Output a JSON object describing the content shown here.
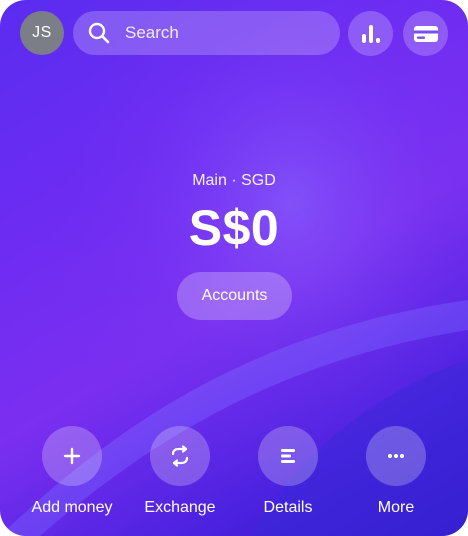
{
  "topbar": {
    "avatar_initials": "JS",
    "search_placeholder": "Search",
    "analytics_icon": "bar-chart-icon",
    "cards_icon": "card-icon"
  },
  "balance": {
    "account_label": "Main · SGD",
    "amount": "S$0",
    "accounts_button_label": "Accounts"
  },
  "actions": [
    {
      "label": "Add money",
      "icon": "plus-icon"
    },
    {
      "label": "Exchange",
      "icon": "exchange-icon"
    },
    {
      "label": "Details",
      "icon": "details-icon"
    },
    {
      "label": "More",
      "icon": "more-icon"
    }
  ],
  "colors": {
    "background_start": "#5a2cf0",
    "background_end": "#2e17c4",
    "avatar_bg": "#7b7d87",
    "text": "#ffffff"
  }
}
